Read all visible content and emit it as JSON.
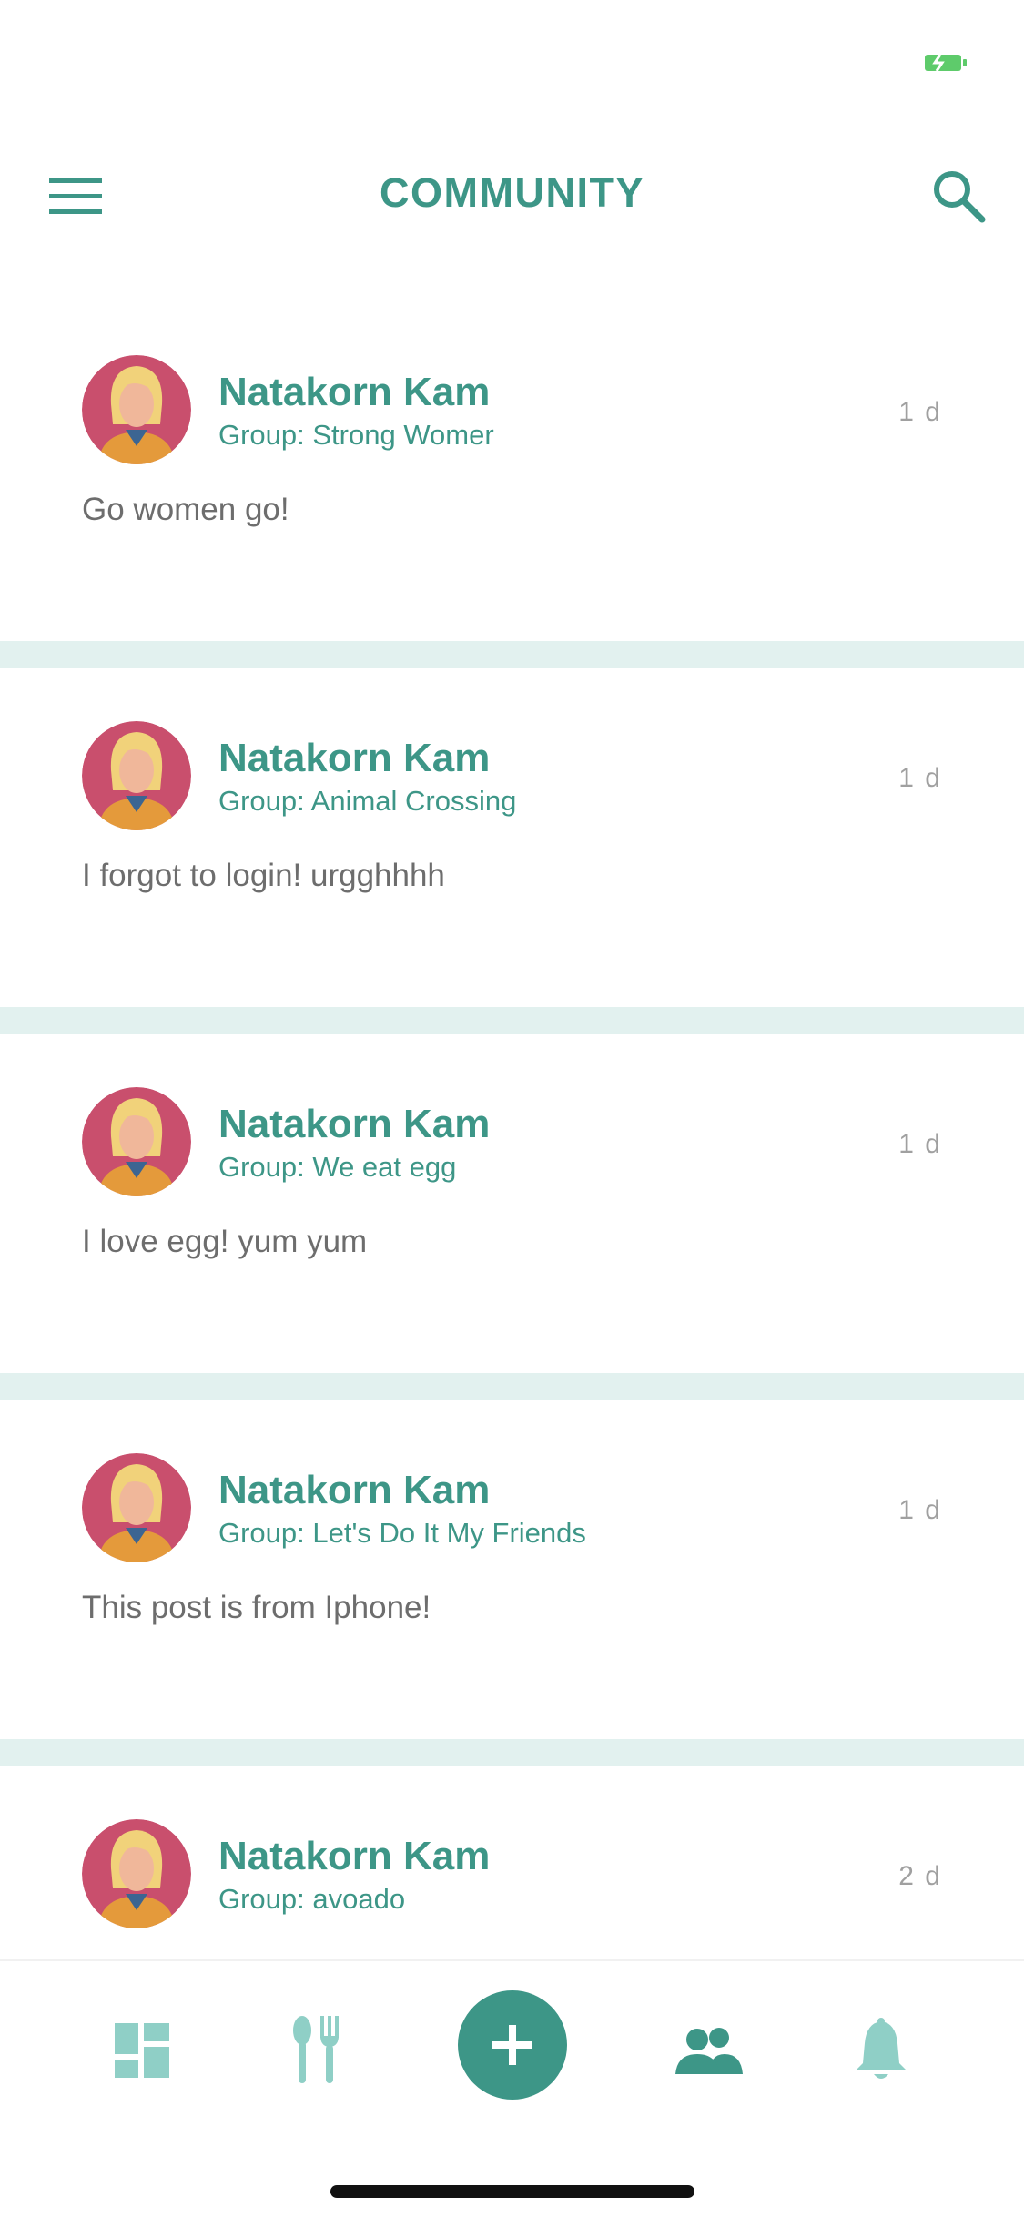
{
  "header": {
    "title": "COMMUNITY"
  },
  "posts": [
    {
      "author": "Natakorn Kam",
      "group": "Group: Strong Womer",
      "time": "1 d",
      "body": "Go women go!"
    },
    {
      "author": "Natakorn Kam",
      "group": "Group: Animal Crossing",
      "time": "1 d",
      "body": "I forgot to login! urgghhhh"
    },
    {
      "author": "Natakorn Kam",
      "group": "Group: We eat egg",
      "time": "1 d",
      "body": "I love egg! yum yum"
    },
    {
      "author": "Natakorn Kam",
      "group": "Group: Let's Do It My Friends",
      "time": "1 d",
      "body": "This post is from Iphone!"
    },
    {
      "author": "Natakorn Kam",
      "group": "Group: avoado",
      "time": "2 d",
      "body": ""
    }
  ],
  "icons": {
    "status": "battery-icon",
    "header_left": "menu-icon",
    "header_right": "search-icon",
    "nav": [
      "dashboard-icon",
      "food-icon",
      "add-icon",
      "community-icon",
      "bell-icon"
    ]
  },
  "colors": {
    "accent": "#3d9687",
    "accent_light": "#8fcfc6",
    "divider": "#e2f1ef",
    "body_text": "#6d6d6d",
    "time_text": "#a0a0a0",
    "battery": "#5ecb6b"
  }
}
